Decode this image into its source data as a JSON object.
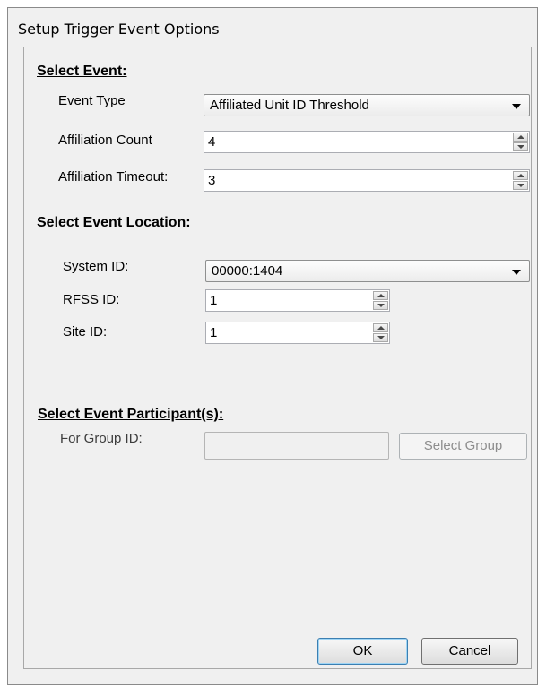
{
  "window": {
    "title": "Setup Trigger Event Options"
  },
  "select_event": {
    "heading": "Select Event:",
    "event_type_label": "Event Type",
    "event_type_value": "Affiliated Unit ID Threshold",
    "affiliation_count_label": "Affiliation Count",
    "affiliation_count_value": "4",
    "affiliation_timeout_label": "Affiliation Timeout:",
    "affiliation_timeout_value": "3"
  },
  "location": {
    "heading": "Select Event Location:",
    "system_id_label": "System ID:",
    "system_id_value": "00000:1404",
    "rfss_id_label": "RFSS ID:",
    "rfss_id_value": "1",
    "site_id_label": "Site ID:",
    "site_id_value": "1"
  },
  "participants": {
    "heading": "Select Event Participant(s):",
    "group_id_label": "For Group ID:",
    "group_id_value": "",
    "select_group_button": "Select Group"
  },
  "footer": {
    "ok_label": "OK",
    "cancel_label": "Cancel"
  }
}
